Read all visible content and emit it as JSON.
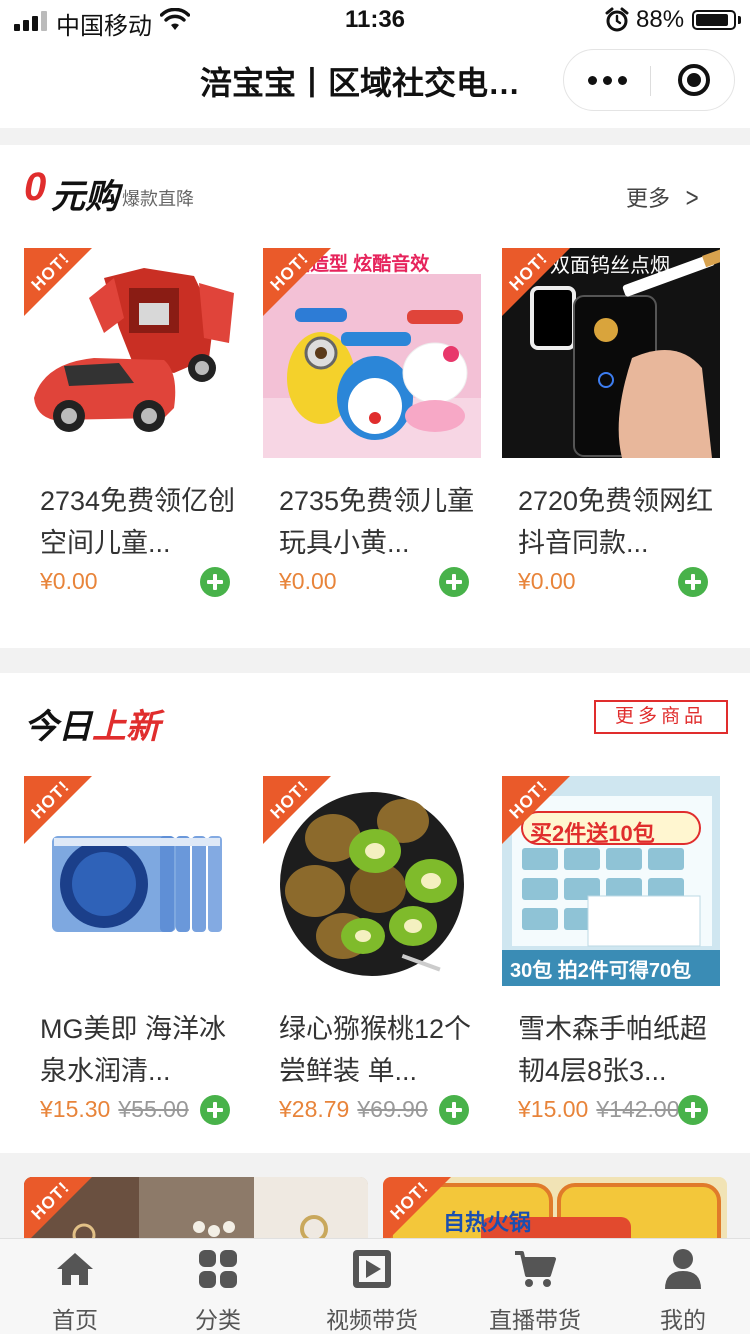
{
  "status_bar": {
    "carrier": "中国移动",
    "time": "11:36",
    "battery": "88%",
    "battery_level": 0.88
  },
  "nav": {
    "title": "涪宝宝丨区域社交电…"
  },
  "free_section": {
    "title_zero": "0",
    "title_rest": "元购",
    "subtitle": "爆款直降",
    "more_label": "更多",
    "products": [
      {
        "name": "2734免费领亿创空间儿童...",
        "price": "¥0.00",
        "hot": "HOT!",
        "banner": ""
      },
      {
        "name": "2735免费领儿童玩具小黄...",
        "price": "¥0.00",
        "hot": "HOT!",
        "banner": "变造型 炫酷音效"
      },
      {
        "name": "2720免费领网红抖音同款...",
        "price": "¥0.00",
        "hot": "HOT!",
        "banner": "双面钨丝点烟"
      }
    ]
  },
  "new_section": {
    "title_black": "今日",
    "title_red": "上新",
    "more_label": "更多商品",
    "products": [
      {
        "name": "MG美即 海洋冰泉水润清...",
        "price": "¥15.30",
        "old_price": "¥55.00",
        "hot": "HOT!",
        "banner": ""
      },
      {
        "name": "绿心猕猴桃12个尝鲜装 单...",
        "price": "¥28.79",
        "old_price": "¥69.90",
        "hot": "HOT!",
        "banner": ""
      },
      {
        "name": "雪木森手帕纸超韧4层8张3...",
        "price": "¥15.00",
        "old_price": "¥142.00",
        "hot": "HOT!",
        "banner": "买2件送10包",
        "banner2": "30包 拍2件可得70包"
      }
    ]
  },
  "more_products": [
    {
      "hot": "HOT!"
    },
    {
      "hot": "HOT!",
      "banner": "自热火锅"
    }
  ],
  "tab_bar": {
    "items": [
      {
        "label": "首页",
        "icon": "home-icon"
      },
      {
        "label": "分类",
        "icon": "category-grid-icon"
      },
      {
        "label": "视频带货",
        "icon": "video-play-icon"
      },
      {
        "label": "直播带货",
        "icon": "shopping-cart-icon"
      },
      {
        "label": "我的",
        "icon": "user-icon"
      }
    ]
  },
  "colors": {
    "accent_red": "#e02d2d",
    "price_orange": "#e8843a",
    "add_green": "#48b24a",
    "hot_badge": "#ea5a2a"
  }
}
